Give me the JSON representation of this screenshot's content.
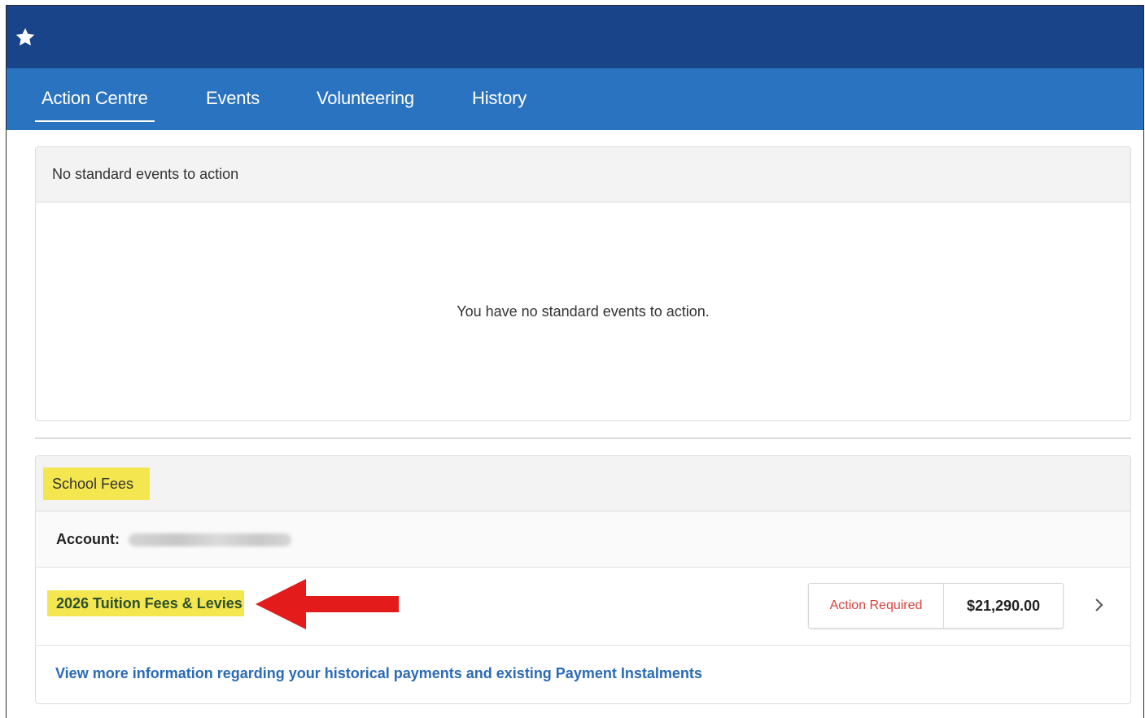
{
  "header": {
    "icon": "star-icon",
    "background": "#1a4489"
  },
  "nav": {
    "background": "#2a73c0",
    "tabs": [
      {
        "label": "Action Centre",
        "active": true
      },
      {
        "label": "Events",
        "active": false
      },
      {
        "label": "Volunteering",
        "active": false
      },
      {
        "label": "History",
        "active": false
      }
    ]
  },
  "standard_events": {
    "title": "No standard events to action",
    "empty_message": "You have no standard events to action."
  },
  "school_fees": {
    "title": "School Fees",
    "account_label": "Account:",
    "account_value_blurred": true,
    "fee_item": {
      "name": "2026 Tuition Fees & Levies",
      "status": "Action Required",
      "amount": "$21,290.00",
      "status_color": "#d9433d"
    },
    "more_info_link": "View more information regarding your historical payments and existing Payment Instalments"
  },
  "annotation": {
    "arrow_color": "#e31b1b",
    "highlight_color": "#f4e64f"
  }
}
